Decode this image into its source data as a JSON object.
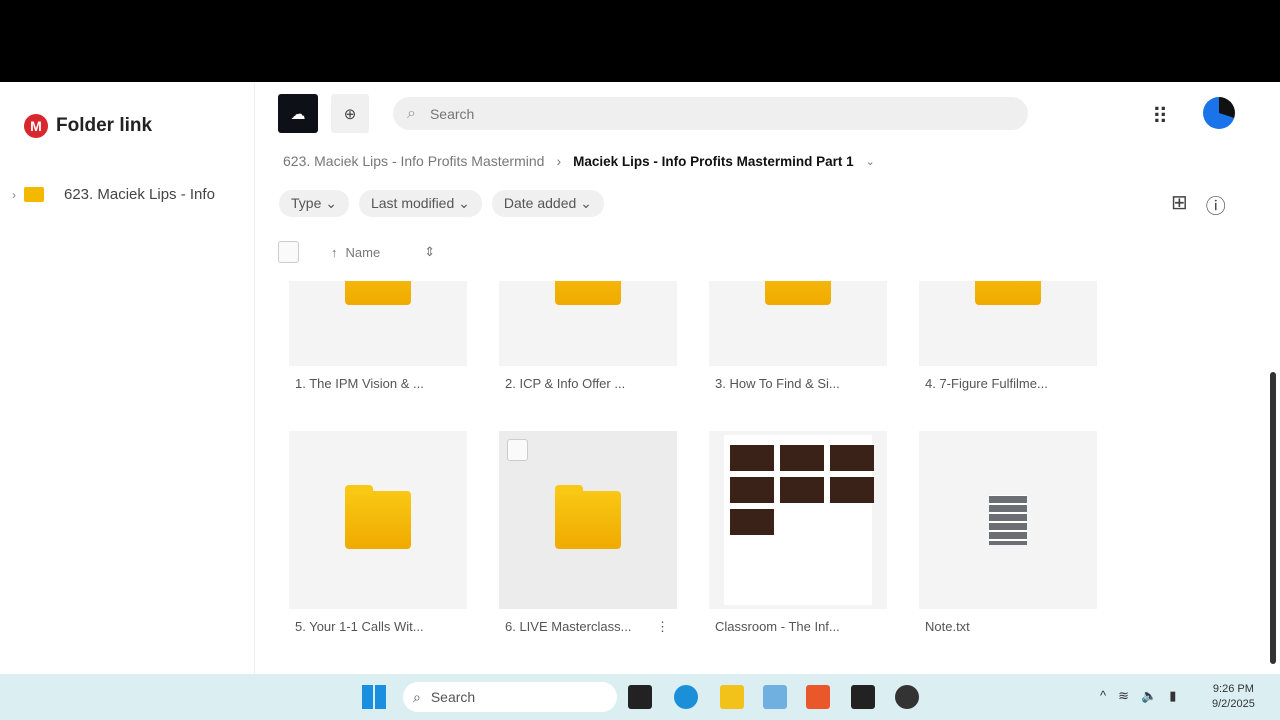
{
  "app": {
    "title": "Folder link",
    "logo_letter": "M"
  },
  "sidebar": {
    "tree_item": "623. Maciek Lips - Info"
  },
  "search": {
    "placeholder": "Search"
  },
  "breadcrumb": {
    "parent": "623. Maciek Lips - Info Profits Mastermind",
    "current": "Maciek Lips - Info Profits Mastermind Part 1"
  },
  "filters": [
    "Type",
    "Last modified",
    "Date added"
  ],
  "list_header": {
    "name": "Name"
  },
  "items": [
    {
      "name": "1. The IPM Vision & ...",
      "type": "folder"
    },
    {
      "name": "2. ICP & Info Offer ...",
      "type": "folder"
    },
    {
      "name": "3. How To Find & Si...",
      "type": "folder"
    },
    {
      "name": "4. 7-Figure Fulfilme...",
      "type": "folder"
    },
    {
      "name": "5. Your 1-1 Calls Wit...",
      "type": "folder"
    },
    {
      "name": "6. LIVE Masterclass...",
      "type": "folder"
    },
    {
      "name": "Classroom - The Inf...",
      "type": "image"
    },
    {
      "name": "Note.txt",
      "type": "text"
    }
  ],
  "taskbar": {
    "search": "Search",
    "time": "9:26 PM",
    "date": "9/2/2025"
  }
}
